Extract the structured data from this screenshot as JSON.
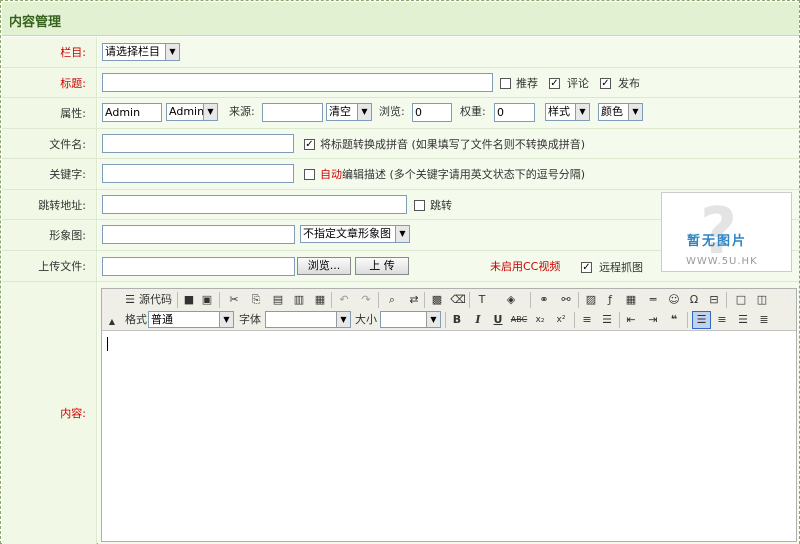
{
  "panel": {
    "title": "内容管理"
  },
  "form": {
    "column": {
      "label": "栏目:",
      "value": "请选择栏目"
    },
    "title": {
      "label": "标题:",
      "value": "",
      "options": [
        {
          "label": "推荐",
          "checked": false
        },
        {
          "label": "评论",
          "checked": true
        },
        {
          "label": "发布",
          "checked": true
        }
      ]
    },
    "attributes": {
      "label": "属性:",
      "author_value": "Admin",
      "author_select": "Admin",
      "source_label": "来源:",
      "source_value": "",
      "clear_select": "清空",
      "views_label": "浏览:",
      "views_value": "0",
      "weight_label": "权重:",
      "weight_value": "0",
      "style_select": "样式",
      "color_select": "颜色"
    },
    "filename": {
      "label": "文件名:",
      "value": "",
      "checkbox_checked": true,
      "checkbox_text": "将标题转换成拼音 (如果填写了文件名则不转换成拼音)"
    },
    "keywords": {
      "label": "关键字:",
      "value": "",
      "checkbox_checked": false,
      "auto_text": "自动",
      "checkbox_text": "编辑描述 (多个关键字请用英文状态下的逗号分隔)"
    },
    "redirect": {
      "label": "跳转地址:",
      "value": "",
      "checkbox_checked": false,
      "checkbox_text": "跳转"
    },
    "image": {
      "label": "形象图:",
      "value": "",
      "select": "不指定文章形象图"
    },
    "upload": {
      "label": "上传文件:",
      "browse": "浏览...",
      "upload_button": "上 传",
      "cc_text": "未启用CC视频",
      "remote_checked": true,
      "remote_text": "远程抓图"
    },
    "preview": {
      "big_text": "暂无图片",
      "small_text": "WWW.5U.HK"
    },
    "content": {
      "label": "内容:"
    }
  },
  "editor": {
    "toolbar1": [
      {
        "name": "source-icon",
        "glyph": "☰"
      },
      {
        "name": "save-icon",
        "glyph": "■"
      },
      {
        "name": "preview-icon",
        "glyph": "▣"
      },
      {
        "name": "cut-icon",
        "glyph": "✂"
      },
      {
        "name": "copy-icon",
        "glyph": "⎘"
      },
      {
        "name": "paste-icon",
        "glyph": "▤"
      },
      {
        "name": "paste-text-icon",
        "glyph": "▥"
      },
      {
        "name": "paste-word-icon",
        "glyph": "▦"
      },
      {
        "name": "undo-icon",
        "glyph": "↶"
      },
      {
        "name": "redo-icon",
        "glyph": "↷"
      },
      {
        "name": "find-icon",
        "glyph": "⌕"
      },
      {
        "name": "replace-icon",
        "glyph": "⇄"
      },
      {
        "name": "select-all-icon",
        "glyph": "▩"
      },
      {
        "name": "remove-format-icon",
        "glyph": "⌫"
      },
      {
        "name": "text-color-icon",
        "glyph": "T"
      },
      {
        "name": "bg-color-icon",
        "glyph": "◈"
      },
      {
        "name": "link-icon",
        "glyph": "⚭"
      },
      {
        "name": "unlink-icon",
        "glyph": "⚯"
      },
      {
        "name": "image-icon",
        "glyph": "▨"
      },
      {
        "name": "flash-icon",
        "glyph": "ƒ"
      },
      {
        "name": "table-icon",
        "glyph": "▦"
      },
      {
        "name": "hr-icon",
        "glyph": "═"
      },
      {
        "name": "smiley-icon",
        "glyph": "☺"
      },
      {
        "name": "special-char-icon",
        "glyph": "Ω"
      },
      {
        "name": "page-break-icon",
        "glyph": "⊟"
      },
      {
        "name": "maximize-icon",
        "glyph": "□"
      },
      {
        "name": "show-blocks-icon",
        "glyph": "◫"
      }
    ],
    "source_label": "源代码",
    "format_label": "格式",
    "format_value": "普通",
    "font_label": "字体",
    "font_value": "",
    "size_label": "大小",
    "size_value": "",
    "toolbar2": [
      {
        "name": "bold-icon",
        "glyph": "B"
      },
      {
        "name": "italic-icon",
        "glyph": "I"
      },
      {
        "name": "underline-icon",
        "glyph": "U"
      },
      {
        "name": "strike-icon",
        "glyph": "ABC"
      },
      {
        "name": "subscript-icon",
        "glyph": "x₂"
      },
      {
        "name": "superscript-icon",
        "glyph": "x²"
      },
      {
        "name": "ordered-list-icon",
        "glyph": "≡"
      },
      {
        "name": "unordered-list-icon",
        "glyph": "☰"
      },
      {
        "name": "outdent-icon",
        "glyph": "⇤"
      },
      {
        "name": "indent-icon",
        "glyph": "⇥"
      },
      {
        "name": "blockquote-icon",
        "glyph": "❝"
      },
      {
        "name": "align-left-icon",
        "glyph": "☰"
      },
      {
        "name": "align-center-icon",
        "glyph": "≡"
      },
      {
        "name": "align-right-icon",
        "glyph": "☰"
      },
      {
        "name": "justify-icon",
        "glyph": "≣"
      }
    ]
  },
  "colors": {
    "label_red": "#cc0000",
    "header_bg": "#e3f1d3",
    "row_bg": "#f4fbec"
  }
}
